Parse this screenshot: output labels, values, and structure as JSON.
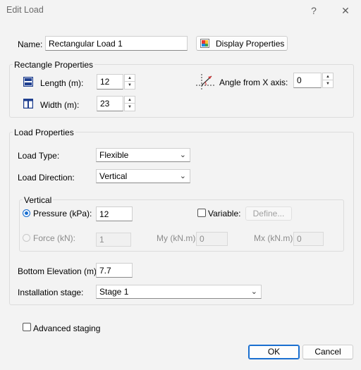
{
  "window": {
    "title": "Edit Load",
    "help": "?",
    "close": "✕"
  },
  "name_row": {
    "label": "Name:",
    "value": "Rectangular Load 1",
    "display_props_label": "Display Properties"
  },
  "rect_props": {
    "title": "Rectangle Properties",
    "length_label": "Length (m):",
    "length_value": "12",
    "width_label": "Width (m):",
    "width_value": "23",
    "angle_label": "Angle from X axis:",
    "angle_value": "0"
  },
  "load_props": {
    "title": "Load Properties",
    "load_type_label": "Load Type:",
    "load_type_value": "Flexible",
    "load_dir_label": "Load Direction:",
    "load_dir_value": "Vertical",
    "vertical": {
      "title": "Vertical",
      "pressure_label": "Pressure (kPa):",
      "pressure_value": "12",
      "variable_label": "Variable:",
      "define_label": "Define...",
      "force_label": "Force (kN):",
      "force_value": "1",
      "my_label": "My (kN.m):",
      "my_value": "0",
      "mx_label": "Mx (kN.m):",
      "mx_value": "0"
    },
    "bottom_elev_label": "Bottom Elevation (m):",
    "bottom_elev_value": "7.7",
    "install_label": "Installation stage:",
    "install_value": "Stage 1"
  },
  "advanced_staging_label": "Advanced staging",
  "buttons": {
    "ok": "OK",
    "cancel": "Cancel"
  },
  "colors": {
    "accent": "#1a6fd0",
    "window_bg": "#f3f3f3"
  },
  "icons": [
    "palette-icon",
    "length-icon",
    "width-icon",
    "angle-icon",
    "chevron-down-icon",
    "spin-up-icon",
    "spin-down-icon"
  ]
}
